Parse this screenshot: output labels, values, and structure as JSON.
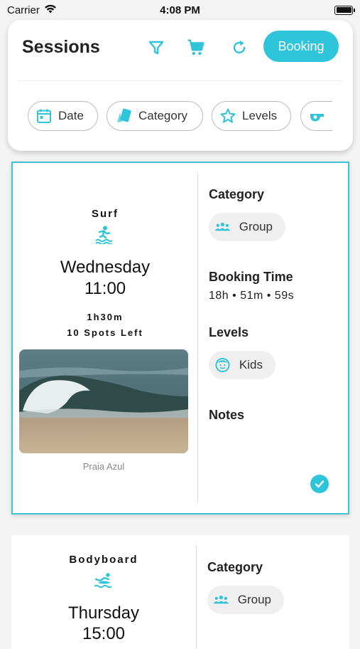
{
  "status_bar": {
    "carrier": "Carrier",
    "time": "4:08 PM"
  },
  "header": {
    "title": "Sessions",
    "booking_label": "Booking",
    "accent_color": "#2ec4d9"
  },
  "filters": [
    {
      "label": "Date",
      "icon": "calendar-icon"
    },
    {
      "label": "Category",
      "icon": "cards-icon"
    },
    {
      "label": "Levels",
      "icon": "star-icon"
    },
    {
      "label": "",
      "icon": "whistle-icon"
    }
  ],
  "sessions": [
    {
      "sport": "Surf",
      "sport_icon": "surfer-icon",
      "day": "Wednesday",
      "time": "11:00",
      "duration": "1h30m",
      "spots": "10 Spots Left",
      "location": "Praia Azul",
      "category_label": "Category",
      "category": "Group",
      "booking_time_label": "Booking Time",
      "booking_time": "18h • 51m • 59s",
      "levels_label": "Levels",
      "level": "Kids",
      "notes_label": "Notes",
      "selected": true
    },
    {
      "sport": "Bodyboard",
      "sport_icon": "bodyboard-icon",
      "day": "Thursday",
      "time": "15:00",
      "category_label": "Category",
      "category": "Group"
    }
  ]
}
